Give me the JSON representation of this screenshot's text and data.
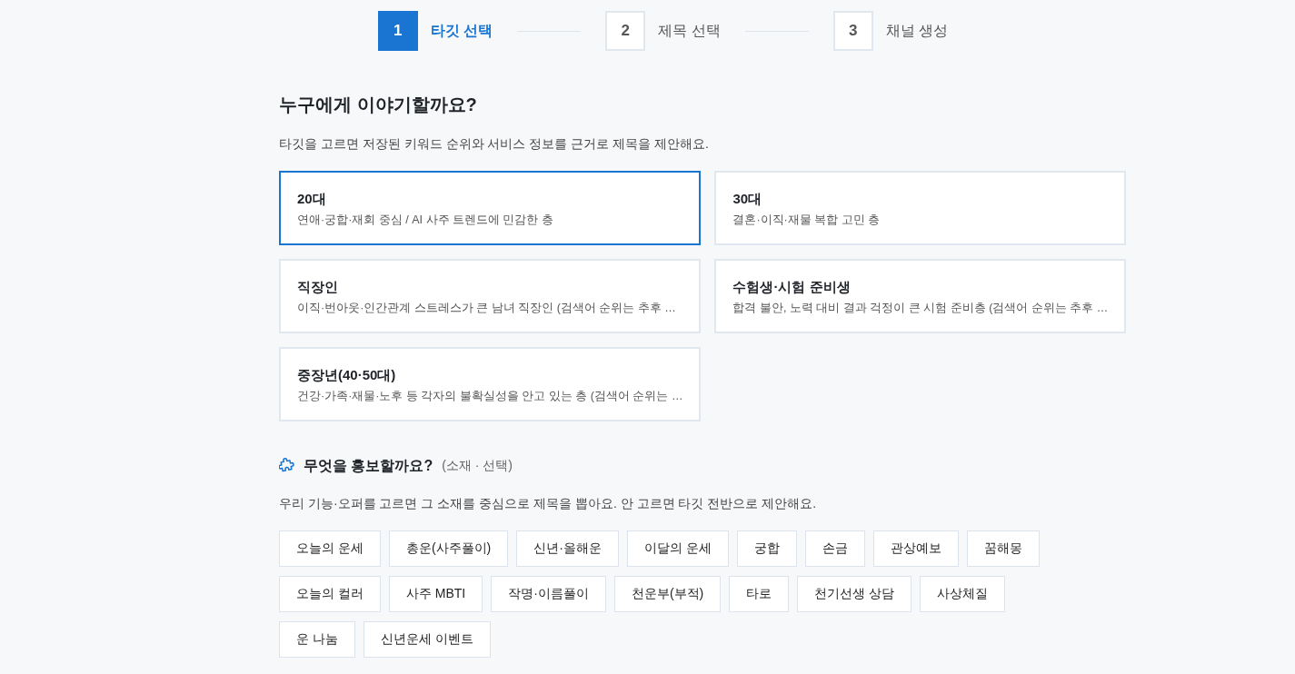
{
  "stepper": [
    {
      "number": "1",
      "label": "타깃 선택",
      "selected": true
    },
    {
      "number": "2",
      "label": "제목 선택",
      "selected": false
    },
    {
      "number": "3",
      "label": "채널 생성",
      "selected": false
    }
  ],
  "target_section": {
    "title": "누구에게 이야기할까요?",
    "description": "타깃을 고르면 저장된 키워드 순위와 서비스 정보를 근거로 제목을 제안해요.",
    "cards": [
      {
        "title": "20대",
        "description": "연애·궁합·재회 중심 / AI 사주 트렌드에 민감한 층",
        "selected": true
      },
      {
        "title": "30대",
        "description": "결혼·이직·재물 복합 고민 층",
        "selected": false
      },
      {
        "title": "직장인",
        "description": "이직·번아웃·인간관계 스트레스가 큰 남녀 직장인 (검색어 순위는 추후 …",
        "selected": false
      },
      {
        "title": "수험생·시험 준비생",
        "description": "합격 불안, 노력 대비 결과 걱정이 큰 시험 준비층 (검색어 순위는 추후 …",
        "selected": false
      },
      {
        "title": "중장년(40·50대)",
        "description": "건강·가족·재물·노후 등 각자의 불확실성을 안고 있는 층 (검색어 순위는 …",
        "selected": false
      }
    ]
  },
  "topic_section": {
    "title": "무엇을 홍보할까요?",
    "note": "(소재 · 선택)",
    "description": "우리 기능·오퍼를 고르면 그 소재를 중심으로 제목을 뽑아요. 안 고르면 타깃 전반으로 제안해요.",
    "chips": [
      {
        "label": "오늘의 운세",
        "selected": false
      },
      {
        "label": "총운(사주풀이)",
        "selected": false
      },
      {
        "label": "신년·올해운",
        "selected": false
      },
      {
        "label": "이달의 운세",
        "selected": false
      },
      {
        "label": "궁합",
        "selected": false
      },
      {
        "label": "손금",
        "selected": false
      },
      {
        "label": "관상예보",
        "selected": false
      },
      {
        "label": "꿈해몽",
        "selected": false
      },
      {
        "label": "오늘의 컬러",
        "selected": false
      },
      {
        "label": "사주 MBTI",
        "selected": false
      },
      {
        "label": "작명·이름풀이",
        "selected": false
      },
      {
        "label": "천운부(부적)",
        "selected": false
      },
      {
        "label": "타로",
        "selected": false
      },
      {
        "label": "천기선생 상담",
        "selected": false
      },
      {
        "label": "사상체질",
        "selected": false
      },
      {
        "label": "운 나눔",
        "selected": false
      },
      {
        "label": "신년운세 이벤트",
        "selected": false
      }
    ]
  }
}
